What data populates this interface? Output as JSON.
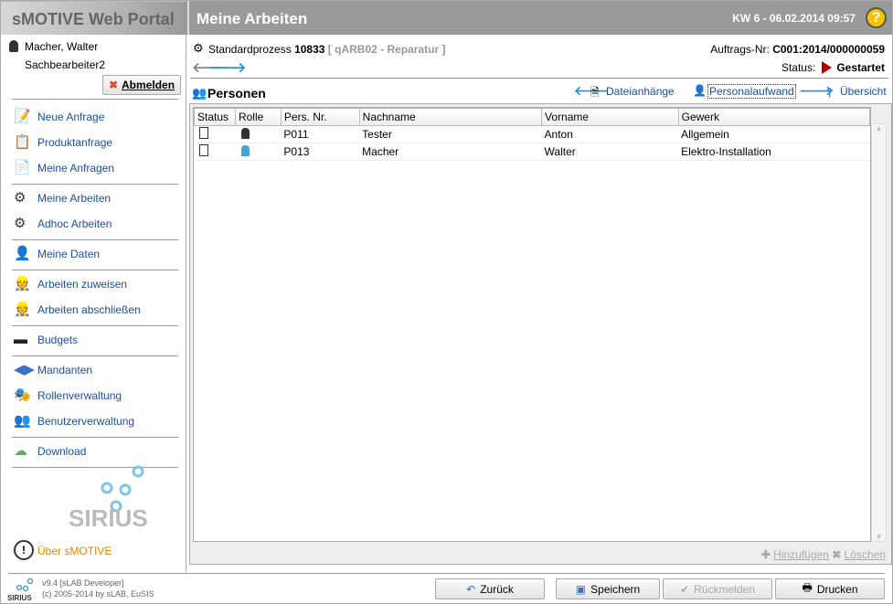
{
  "app": {
    "title": "sMOTIVE Web Portal",
    "page_title": "Meine Arbeiten",
    "datetime": "KW 6 - 06.02.2014 09:57",
    "help_label": "?"
  },
  "user": {
    "name": "Macher, Walter",
    "role": "Sachbearbeiter2",
    "logout": "Abmelden"
  },
  "sidebar": {
    "items": [
      {
        "label": "Neue Anfrage",
        "icon": "new-request-icon"
      },
      {
        "label": "Produktanfrage",
        "icon": "product-request-icon"
      },
      {
        "label": "Meine Anfragen",
        "icon": "my-requests-icon"
      },
      {
        "label": "Meine Arbeiten",
        "icon": "gears-icon"
      },
      {
        "label": "Adhoc Arbeiten",
        "icon": "adhoc-gear-icon"
      },
      {
        "label": "Meine Daten",
        "icon": "user-icon"
      },
      {
        "label": "Arbeiten zuweisen",
        "icon": "worker-assign-icon"
      },
      {
        "label": "Arbeiten abschließen",
        "icon": "worker-complete-icon"
      },
      {
        "label": "Budgets",
        "icon": "wallet-icon"
      },
      {
        "label": "Mandanten",
        "icon": "clients-icon"
      },
      {
        "label": "Rollenverwaltung",
        "icon": "masks-icon"
      },
      {
        "label": "Benutzerverwaltung",
        "icon": "users-icon"
      },
      {
        "label": "Download",
        "icon": "cloud-download-icon"
      }
    ],
    "logo_text": "SIRIUS",
    "about": "Über sMOTIVE"
  },
  "process": {
    "label": "Standardprozess",
    "number": "10833",
    "type": "[ qARB02 - Reparatur ]",
    "order_label": "Auftrags-Nr:",
    "order_no": "C001:2014/000000059",
    "status_label": "Status:",
    "status": "Gestartet"
  },
  "section": {
    "title": "Personen",
    "links": {
      "attachments": "Dateianhänge",
      "personnel": "Personalaufwand",
      "overview": "Übersicht"
    }
  },
  "table": {
    "columns": [
      "Status",
      "Rolle",
      "Pers. Nr.",
      "Nachname",
      "Vorname",
      "Gewerk"
    ],
    "rows": [
      [
        "",
        "",
        "P011",
        "Tester",
        "Anton",
        "Allgemein"
      ],
      [
        "",
        "",
        "P013",
        "Macher",
        "Walter",
        "Elektro-Installation"
      ]
    ]
  },
  "table_actions": {
    "add": "Hinzufügen",
    "delete": "Löschen"
  },
  "footer": {
    "version": "v9.4 [sLAB Developer]",
    "copyright": "(c) 2005-2014 by sLAB, EuSIS",
    "logo_text": "SIRIUS",
    "buttons": {
      "back": "Zurück",
      "save": "Speichern",
      "report": "Rückmelden",
      "print": "Drucken"
    }
  },
  "colors": {
    "link": "#1a4fa0",
    "header": "#9a9a9a",
    "status": "#b00000",
    "accent_arrow": "#2e8fd8",
    "about": "#e08a00"
  }
}
